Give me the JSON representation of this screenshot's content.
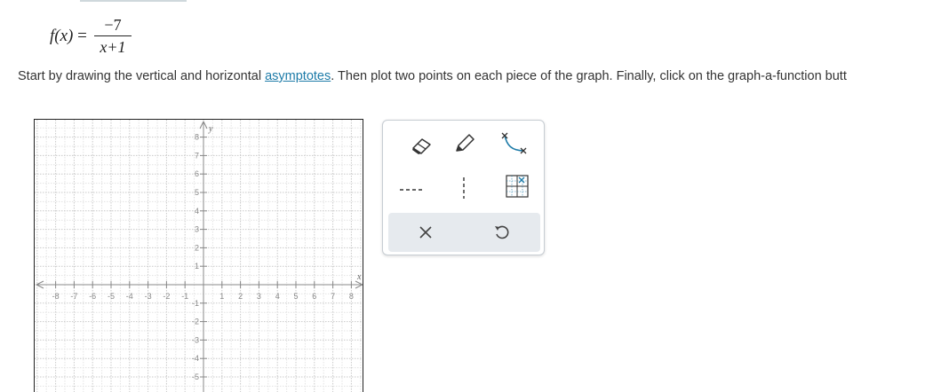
{
  "formula": {
    "lhs": "f(x)",
    "eq": "=",
    "numerator": "−7",
    "denominator": "x+1"
  },
  "instructions": {
    "before": "Start by drawing the vertical and horizontal ",
    "link": "asymptotes",
    "after": ". Then plot two points on each piece of the graph. Finally, click on the graph-a-function butt"
  },
  "graph": {
    "x_axis_label": "x",
    "y_axis_label": "y",
    "x_ticks": [
      "-8",
      "-7",
      "-6",
      "-5",
      "-4",
      "-3",
      "-2",
      "-1",
      "1",
      "2",
      "3",
      "4",
      "5",
      "6",
      "7",
      "8"
    ],
    "y_ticks": [
      "8",
      "7",
      "6",
      "5",
      "4",
      "3",
      "2",
      "1",
      "-1",
      "-2",
      "-3",
      "-4",
      "-5"
    ]
  },
  "toolbox": {
    "tools": [
      "eraser-icon",
      "pencil-icon",
      "graph-curve-icon",
      "horizontal-dashed-line-icon",
      "vertical-dashed-line-icon",
      "grid-point-icon"
    ],
    "actions": [
      "clear-icon",
      "undo-icon"
    ],
    "accent_color": "#1d7ba8"
  }
}
